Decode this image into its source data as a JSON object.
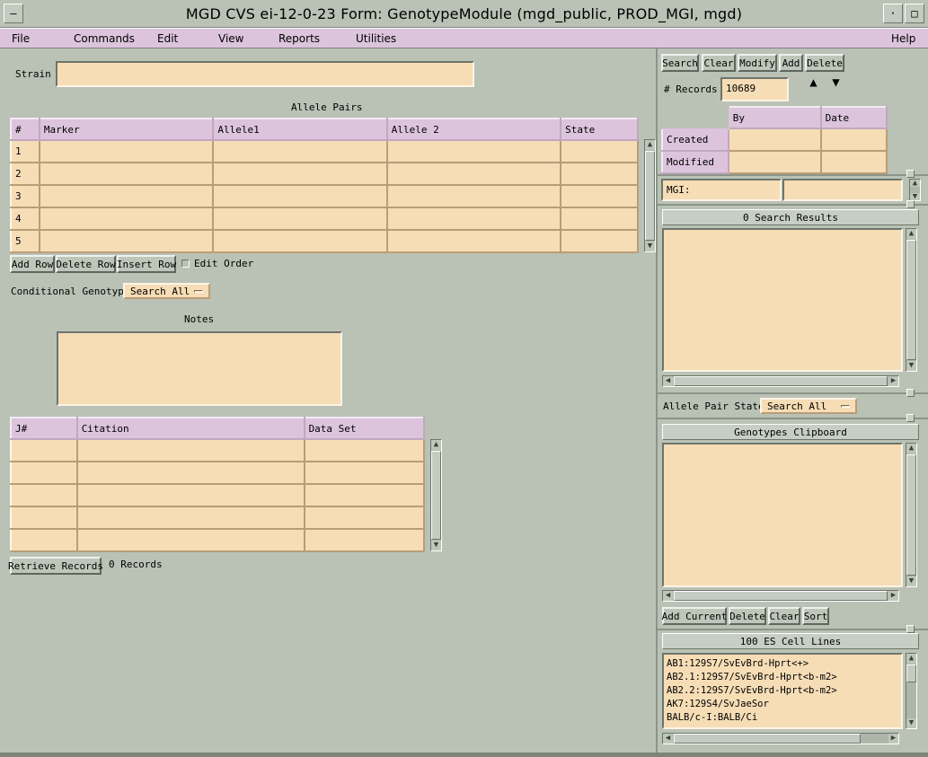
{
  "window": {
    "title": "MGD CVS ei-12-0-23  Form:  GenotypeModule  (mgd_public, PROD_MGI, mgd)",
    "minimize_glyph": "·",
    "maximize_glyph": "□",
    "menu_glyph": "—"
  },
  "menubar": {
    "items": [
      "File",
      "Commands",
      "Edit",
      "View",
      "Reports",
      "Utilities"
    ],
    "help": "Help"
  },
  "strain": {
    "label": "Strain",
    "value": ""
  },
  "allele_pairs": {
    "title": "Allele Pairs",
    "columns": [
      "#",
      "Marker",
      "Allele1",
      "Allele 2",
      "State"
    ],
    "rows": [
      "1",
      "2",
      "3",
      "4",
      "5"
    ],
    "buttons": {
      "add_row": "Add Row",
      "delete_row": "Delete Row",
      "insert_row": "Insert Row"
    },
    "edit_order_label": "Edit Order"
  },
  "conditional": {
    "label": "Conditional Genotype",
    "value": "Search All"
  },
  "notes": {
    "label": "Notes",
    "value": ""
  },
  "references": {
    "columns": [
      "J#",
      "Citation",
      "Data Set"
    ],
    "row_count": 5,
    "retrieve_button": "Retrieve Records",
    "records_text": "0 Records"
  },
  "control": {
    "buttons": [
      "Search",
      "Clear",
      "Modify",
      "Add",
      "Delete"
    ],
    "records_label": "# Records",
    "records_value": "10689",
    "up_arrow": "▲",
    "down_arrow": "▼",
    "audit_columns": [
      "By",
      "Date"
    ],
    "audit_rows": [
      "Created",
      "Modified"
    ]
  },
  "mgi": {
    "label": "MGI:",
    "value": ""
  },
  "search_results": {
    "title": "0 Search Results"
  },
  "allele_pair_state": {
    "label": "Allele Pair State",
    "value": "Search All"
  },
  "clipboard": {
    "title": "Genotypes Clipboard",
    "buttons": [
      "Add Current",
      "Delete",
      "Clear",
      "Sort"
    ]
  },
  "es_cell_lines": {
    "title": "100 ES Cell Lines",
    "items": [
      "AB1:129S7/SvEvBrd-Hprt<+>",
      "AB2.1:129S7/SvEvBrd-Hprt<b-m2>",
      "AB2.2:129S7/SvEvBrd-Hprt<b-m2>",
      "AK7:129S4/SvJaeSor",
      "BALB/c-I:BALB/Ci"
    ]
  },
  "colors": {
    "background": "#b9c2b5",
    "menubar": "#dbc4dc",
    "field": "#f6ddb6",
    "header": "#dbc4dc"
  }
}
